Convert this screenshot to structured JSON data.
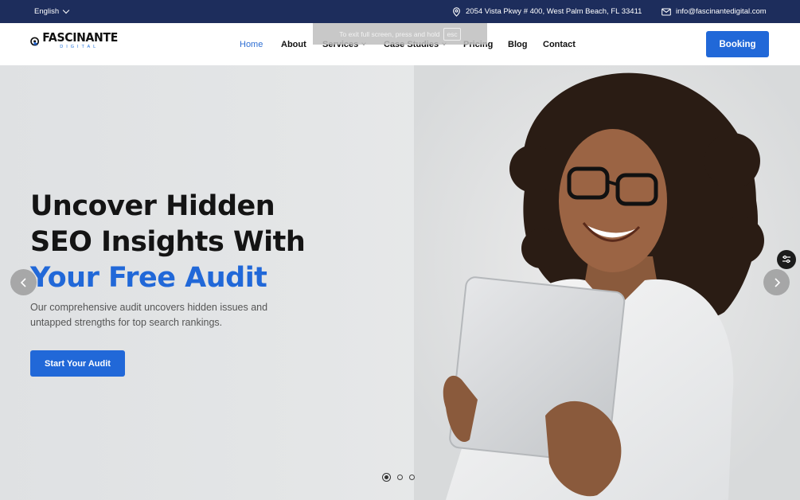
{
  "topbar": {
    "language": "English",
    "address": "2054 Vista Pkwy # 400, West Palm Beach, FL 33411",
    "email": "info@fascinantedigital.com"
  },
  "header": {
    "logo_main": "FASCINANTE",
    "logo_sub": "DIGITAL",
    "nav": [
      {
        "label": "Home",
        "active": true
      },
      {
        "label": "About"
      },
      {
        "label": "Services",
        "dropdown": true
      },
      {
        "label": "Case Studies",
        "dropdown": true
      },
      {
        "label": "Pricing"
      },
      {
        "label": "Blog"
      },
      {
        "label": "Contact"
      }
    ],
    "booking_label": "Booking"
  },
  "fullscreen_notice": {
    "text": "To exit full screen, press and hold",
    "key": "esc"
  },
  "hero": {
    "headline_line1": "Uncover Hidden",
    "headline_line2": "SEO Insights With",
    "headline_line3": "Your Free Audit",
    "subtext": "Our comprehensive audit uncovers hidden issues and untapped strengths for top search rankings.",
    "cta_label": "Start Your Audit",
    "slides": 3,
    "active_slide": 1
  },
  "colors": {
    "topbar_bg": "#1d2d5c",
    "accent": "#2168d8",
    "nav_active": "#2f6fd3"
  },
  "icons": {
    "location": "map-pin-icon",
    "email": "envelope-icon",
    "prev": "chevron-left-icon",
    "next": "chevron-right-icon",
    "widget": "sliders-icon"
  }
}
